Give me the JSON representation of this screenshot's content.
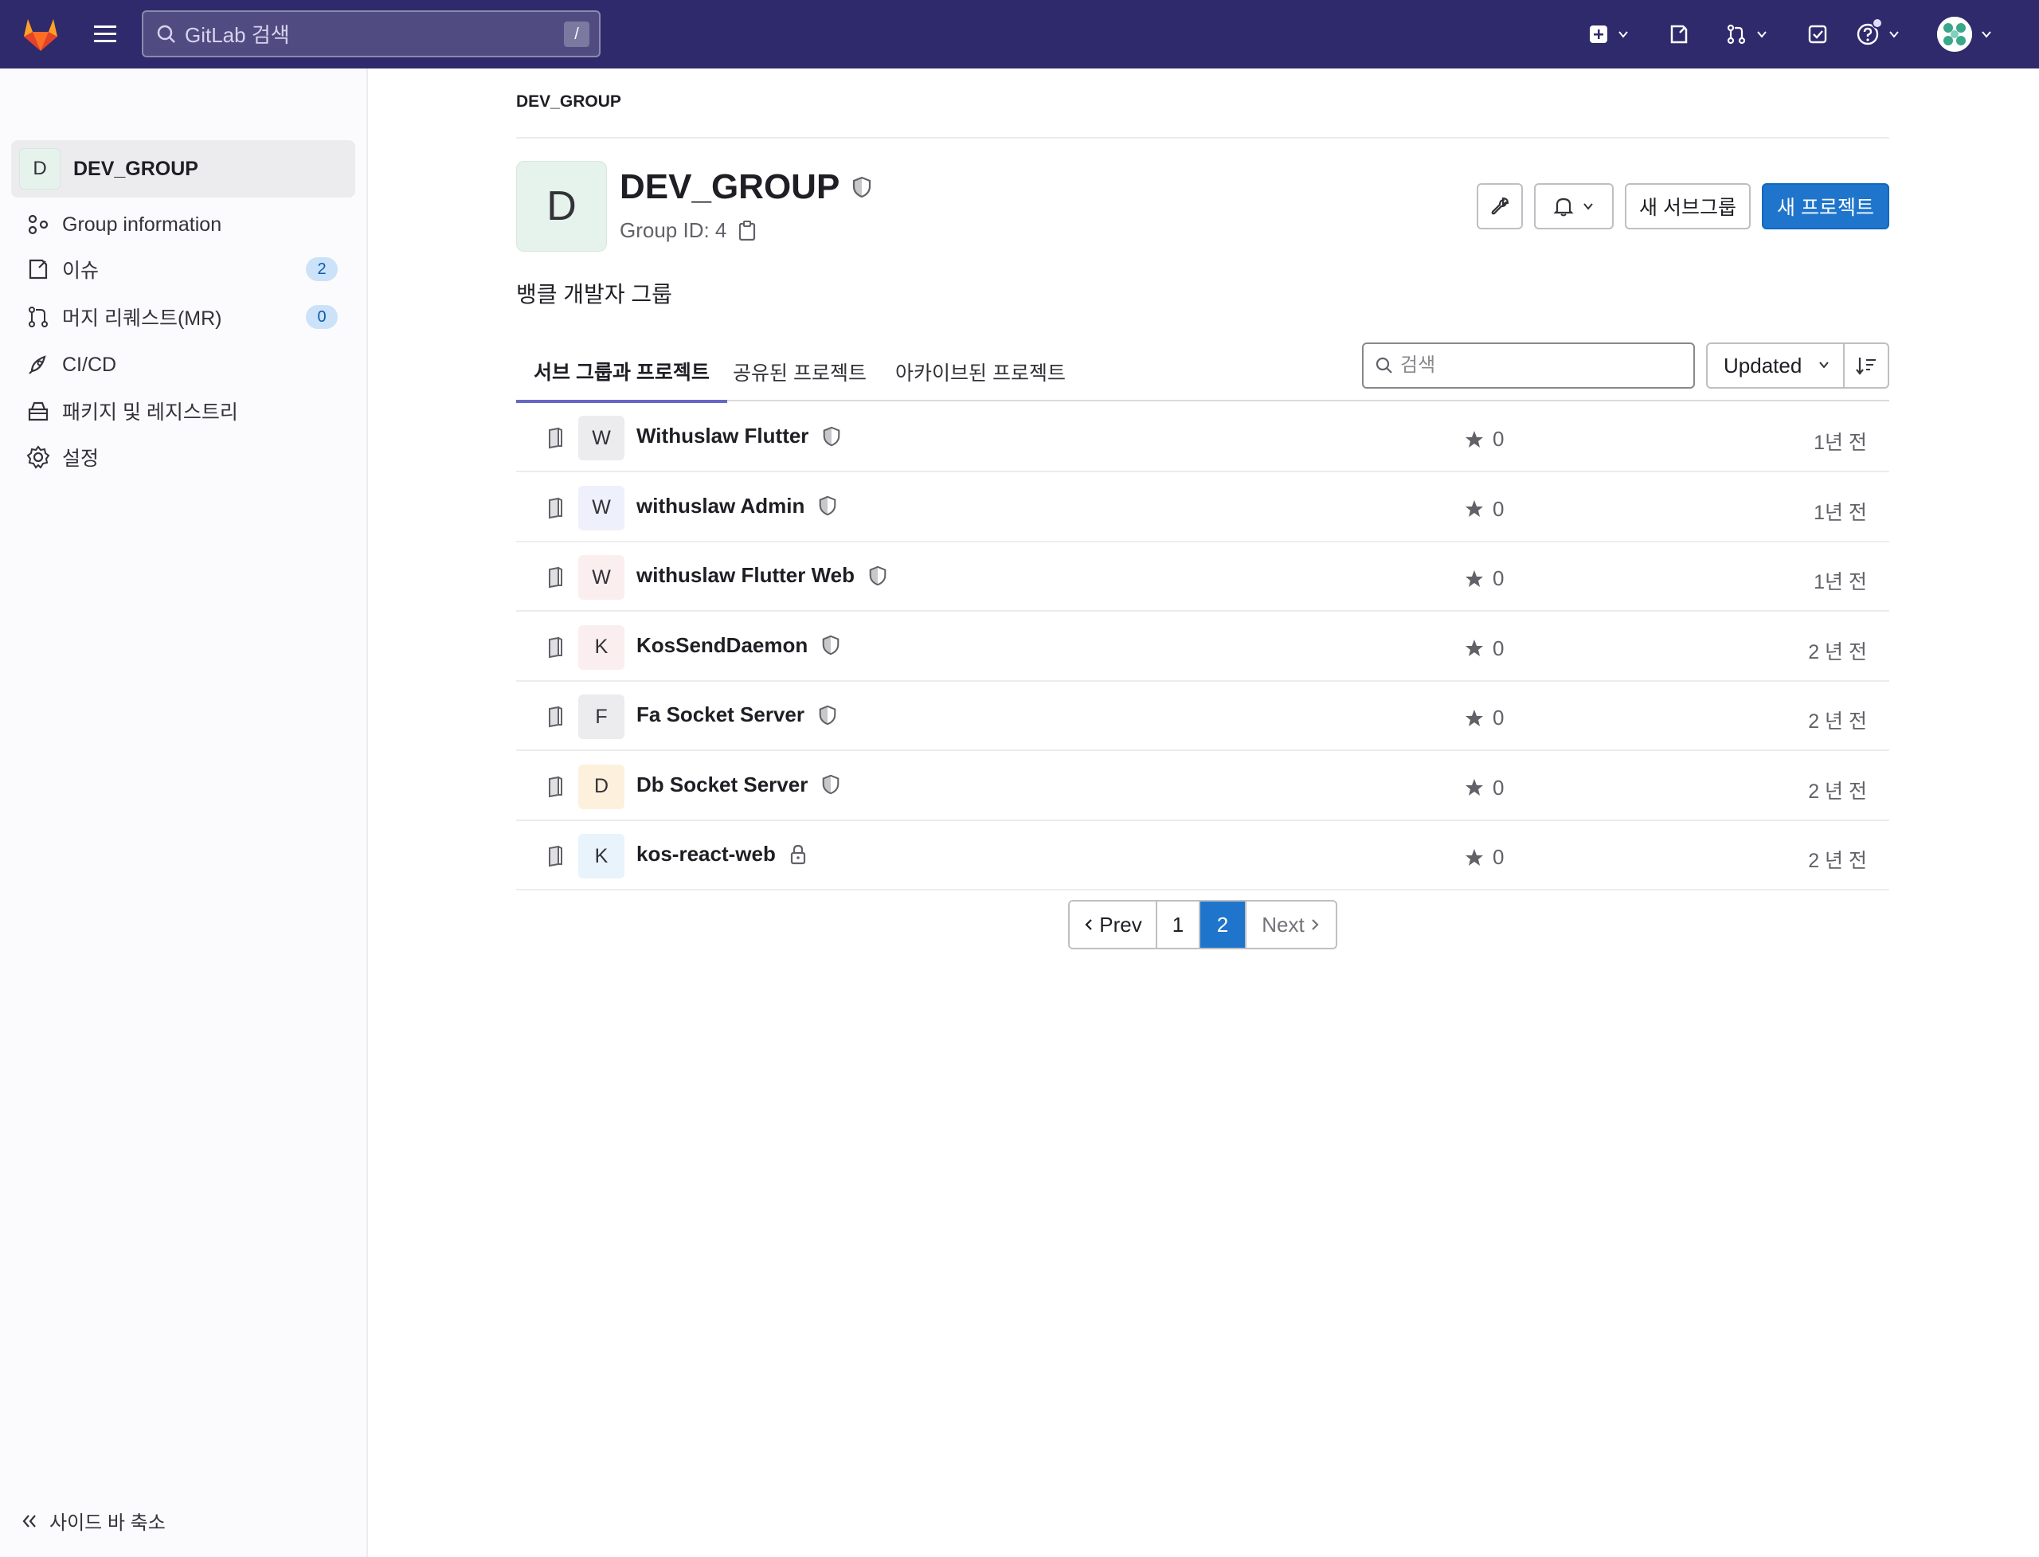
{
  "topbar": {
    "search_placeholder": "GitLab 검색",
    "search_shortcut": "/"
  },
  "sidebar": {
    "group_initial": "D",
    "group_name": "DEV_GROUP",
    "items": [
      {
        "label": "Group information",
        "icon": "group-info-icon"
      },
      {
        "label": "이슈",
        "icon": "issues-icon",
        "badge": "2"
      },
      {
        "label": "머지 리퀘스트(MR)",
        "icon": "merge-request-icon",
        "badge": "0"
      },
      {
        "label": "CI/CD",
        "icon": "rocket-icon"
      },
      {
        "label": "패키지 및 레지스트리",
        "icon": "package-icon"
      },
      {
        "label": "설정",
        "icon": "gear-icon"
      }
    ],
    "collapse_label": "사이드 바 축소"
  },
  "main": {
    "breadcrumb": "DEV_GROUP",
    "group": {
      "initial": "D",
      "title": "DEV_GROUP",
      "id_text": "Group ID: 4",
      "description": "뱅클 개발자 그룹"
    },
    "actions": {
      "new_subgroup": "새 서브그룹",
      "new_project": "새 프로젝트"
    },
    "tabs": [
      "서브 그룹과 프로젝트",
      "공유된 프로젝트",
      "아카이브된 프로젝트"
    ],
    "filter_placeholder": "검색",
    "sort_label": "Updated",
    "projects": [
      {
        "initial": "W",
        "name": "Withuslaw Flutter",
        "visibility": "shield-icon",
        "stars": "0",
        "updated": "1년 전",
        "avatar_bg": "#ececef"
      },
      {
        "initial": "W",
        "name": "withuslaw Admin",
        "visibility": "shield-icon",
        "stars": "0",
        "updated": "1년 전",
        "avatar_bg": "#eef0fb"
      },
      {
        "initial": "W",
        "name": "withuslaw Flutter Web",
        "visibility": "shield-icon",
        "stars": "0",
        "updated": "1년 전",
        "avatar_bg": "#fbeeee"
      },
      {
        "initial": "K",
        "name": "KosSendDaemon",
        "visibility": "shield-icon",
        "stars": "0",
        "updated": "2 년 전",
        "avatar_bg": "#fbeeee"
      },
      {
        "initial": "F",
        "name": "Fa Socket Server",
        "visibility": "shield-icon",
        "stars": "0",
        "updated": "2 년 전",
        "avatar_bg": "#ececef"
      },
      {
        "initial": "D",
        "name": "Db Socket Server",
        "visibility": "shield-icon",
        "stars": "0",
        "updated": "2 년 전",
        "avatar_bg": "#fdf1dd"
      },
      {
        "initial": "K",
        "name": "kos-react-web",
        "visibility": "lock-icon",
        "stars": "0",
        "updated": "2 년 전",
        "avatar_bg": "#e9f3fc"
      }
    ],
    "pagination": {
      "prev": "Prev",
      "pages": [
        "1",
        "2"
      ],
      "current": "2",
      "next": "Next"
    }
  },
  "colors": {
    "topbar_bg": "#2f2a6b",
    "primary": "#1f75cb",
    "active_tab": "#6666c4"
  }
}
